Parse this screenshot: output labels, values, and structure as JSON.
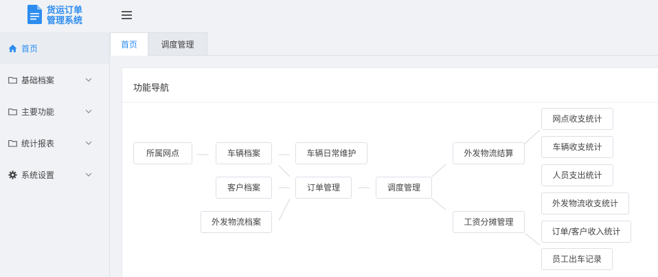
{
  "app": {
    "title_line1": "货运订单",
    "title_line2": "管理系统",
    "logo_icon": "document-icon",
    "accent_color": "#2d8cf0"
  },
  "sidebar": {
    "items": [
      {
        "label": "首页",
        "icon": "home-icon",
        "active": true
      },
      {
        "label": "基础档案",
        "icon": "folder-icon",
        "expandable": true
      },
      {
        "label": "主要功能",
        "icon": "folder-icon",
        "expandable": true
      },
      {
        "label": "统计报表",
        "icon": "folder-icon",
        "expandable": true
      },
      {
        "label": "系统设置",
        "icon": "gear-icon",
        "expandable": true
      }
    ]
  },
  "tabs": [
    {
      "label": "首页",
      "active": true
    },
    {
      "label": "调度管理",
      "active": false
    }
  ],
  "main": {
    "card_title": "功能导航",
    "nodes": {
      "branch": "所属网点",
      "vehicle_archive": "车辆档案",
      "customer_archive": "客户档案",
      "outbound_archive": "外发物流档案",
      "vehicle_maintenance": "车辆日常维护",
      "order_management": "订单管理",
      "dispatch_management": "调度管理",
      "outbound_settlement": "外发物流结算",
      "salary_allocation": "工资分摊管理",
      "branch_stats": "网点收支统计",
      "vehicle_stats": "车辆收支统计",
      "staff_expense_stats": "人员支出统计",
      "outbound_stats": "外发物流收支统计",
      "order_customer_income_stats": "订单/客户收入统计",
      "employee_trip_records": "员工出车记录"
    }
  }
}
